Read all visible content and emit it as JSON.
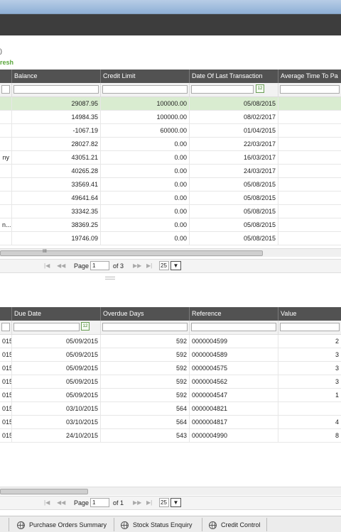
{
  "top": {
    "info_fragment": ")",
    "refresh_label": "resh"
  },
  "grid1": {
    "headers": [
      "",
      "Balance",
      "Credit Limit",
      "Date Of Last Transaction",
      "Average Time To Pa"
    ],
    "rows": [
      [
        "",
        "29087.95",
        "100000.00",
        "05/08/2015",
        ""
      ],
      [
        "",
        "14984.35",
        "100000.00",
        "08/02/2017",
        ""
      ],
      [
        "",
        "-1067.19",
        "60000.00",
        "01/04/2015",
        ""
      ],
      [
        "",
        "28027.82",
        "0.00",
        "22/03/2017",
        ""
      ],
      [
        "ny",
        "43051.21",
        "0.00",
        "16/03/2017",
        ""
      ],
      [
        "",
        "40265.28",
        "0.00",
        "24/03/2017",
        ""
      ],
      [
        "",
        "33569.41",
        "0.00",
        "05/08/2015",
        ""
      ],
      [
        "",
        "49641.64",
        "0.00",
        "05/08/2015",
        ""
      ],
      [
        "",
        "33342.35",
        "0.00",
        "05/08/2015",
        ""
      ],
      [
        "n...",
        "38369.25",
        "0.00",
        "05/08/2015",
        ""
      ],
      [
        "",
        "19746.09",
        "0.00",
        "05/08/2015",
        ""
      ]
    ],
    "scroll_grip": "III",
    "pager": {
      "first": "|◀",
      "prev": "◀◀",
      "page_label": "Page",
      "page_value": "1",
      "of_label": "of 3",
      "next": "▶▶",
      "last": "▶|",
      "page_size": "25",
      "dropdown": "▼"
    }
  },
  "grid2": {
    "headers": [
      "",
      "Due Date",
      "Overdue Days",
      "Reference",
      "Value"
    ],
    "rows": [
      [
        "015",
        "05/09/2015",
        "592",
        "0000004599",
        "2"
      ],
      [
        "015",
        "05/09/2015",
        "592",
        "0000004589",
        "3"
      ],
      [
        "015",
        "05/09/2015",
        "592",
        "0000004575",
        "3"
      ],
      [
        "015",
        "05/09/2015",
        "592",
        "0000004562",
        "3"
      ],
      [
        "015",
        "05/09/2015",
        "592",
        "0000004547",
        "1"
      ],
      [
        "015",
        "03/10/2015",
        "564",
        "0000004821",
        ""
      ],
      [
        "015",
        "03/10/2015",
        "564",
        "0000004817",
        "4"
      ],
      [
        "015",
        "24/10/2015",
        "543",
        "0000004990",
        "8"
      ]
    ],
    "pager": {
      "first": "|◀",
      "prev": "◀◀",
      "page_label": "Page",
      "page_value": "1",
      "of_label": "of 1",
      "next": "▶▶",
      "last": "▶|",
      "page_size": "25",
      "dropdown": "▼"
    }
  },
  "taskbar": {
    "items": [
      "Purchase Orders Summary",
      "Stock Status Enquiry",
      "Credit Control"
    ]
  },
  "colors": {
    "header": "#525252",
    "selected_row": "#d9ecd0",
    "accent_green": "#5aa63b"
  }
}
